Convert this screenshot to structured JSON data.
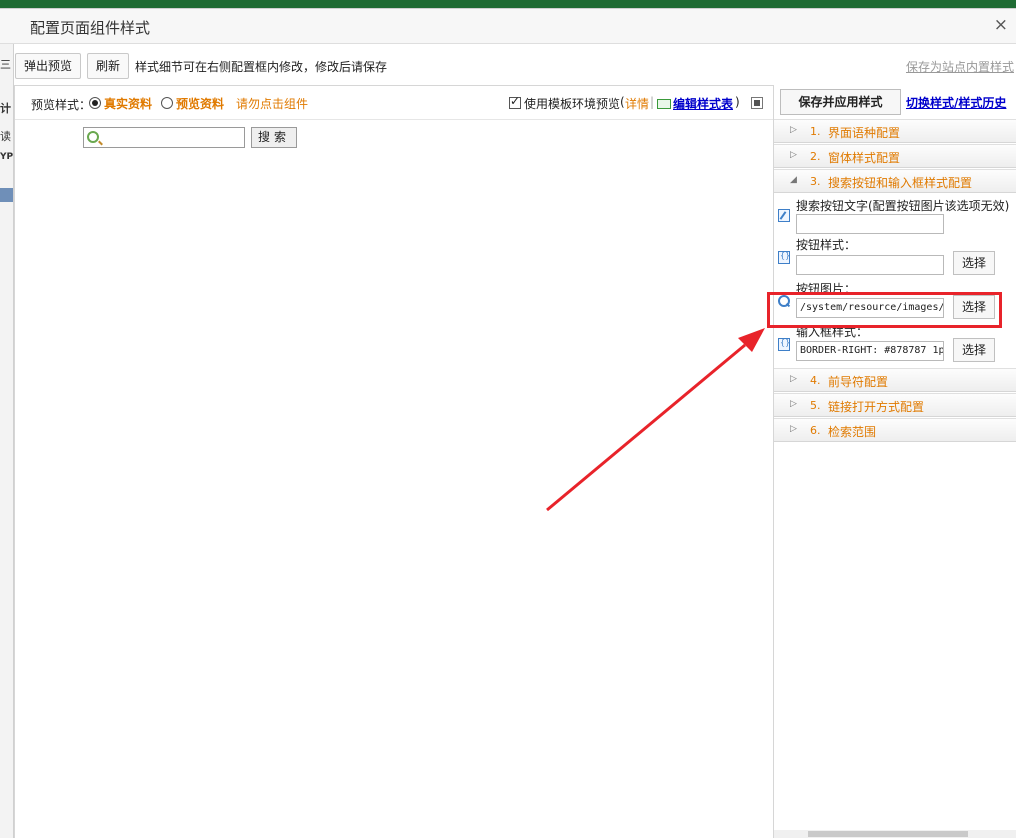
{
  "dialog": {
    "title": "配置页面组件样式",
    "close": "×"
  },
  "toolbar": {
    "popup_preview": "弹出预览",
    "refresh": "刷新",
    "tip": "样式细节可在右侧配置框内修改，修改后请保存",
    "save_as_builtin": "保存为站点内置样式"
  },
  "background": {
    "left_fragments": [
      "三",
      "计",
      "读",
      "YP"
    ]
  },
  "preview": {
    "style_label": "预览样式：",
    "real_data": "真实资料",
    "preview_data": "预览资料",
    "hint": "请勿点击组件",
    "template_env": "使用模板环境预览",
    "details_open": "(",
    "details": "详情",
    "separator": "|",
    "edit_css": "编辑样式表",
    "details_close": ")",
    "search_button": "搜索",
    "search_value": ""
  },
  "config": {
    "apply_button": "保存并应用样式",
    "history_link": "切换样式/样式历史",
    "sections": [
      {
        "num": "1.",
        "label": "界面语种配置",
        "arrow": "▷"
      },
      {
        "num": "2.",
        "label": "窗体样式配置",
        "arrow": "▷"
      },
      {
        "num": "3.",
        "label": "搜索按钮和输入框样式配置",
        "arrow": "◢"
      },
      {
        "num": "4.",
        "label": "前导符配置",
        "arrow": "▷"
      },
      {
        "num": "5.",
        "label": "链接打开方式配置",
        "arrow": "▷"
      },
      {
        "num": "6.",
        "label": "检索范围",
        "arrow": "▷"
      }
    ],
    "fields": {
      "btn_text_label": "搜索按钮文字(配置按钮图片该选项无效)",
      "btn_text_value": "",
      "btn_style_label": "按钮样式：",
      "btn_style_value": "",
      "btn_image_label": "按钮图片：",
      "btn_image_value": "/system/resource/images/",
      "input_style_label": "输入框样式：",
      "input_style_value": "BORDER-RIGHT: #878787 1p",
      "choose": "选择"
    }
  }
}
